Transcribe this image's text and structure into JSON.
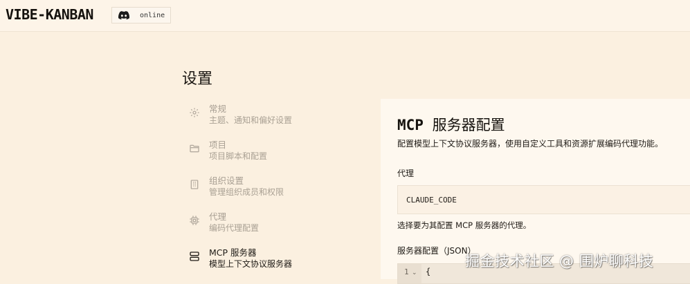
{
  "app": {
    "logo": "VIBE-KANBAN",
    "discord_status": "online",
    "discord_icon": "discord-icon"
  },
  "settings": {
    "title": "设置"
  },
  "sidebar": {
    "items": [
      {
        "label": "常规",
        "desc": "主题、通知和偏好设置",
        "icon": "gear-icon"
      },
      {
        "label": "项目",
        "desc": "项目脚本和配置",
        "icon": "folder-icon"
      },
      {
        "label": "组织设置",
        "desc": "管理组织成员和权限",
        "icon": "building-icon"
      },
      {
        "label": "代理",
        "desc": "编码代理配置",
        "icon": "cpu-icon"
      },
      {
        "label": "MCP 服务器",
        "desc": "模型上下文协议服务器",
        "icon": "server-icon",
        "active": true
      }
    ]
  },
  "mcp": {
    "title_prefix": "MCP",
    "title_suffix": "服务器配置",
    "description": "配置模型上下文协议服务器，使用自定义工具和资源扩展编码代理功能。",
    "agent_label": "代理",
    "agent_value": "CLAUDE_CODE",
    "agent_hint": "选择要为其配置 MCP 服务器的代理。",
    "json_label": "服务器配置（JSON）",
    "editor": {
      "line_number": "1",
      "fold": "⌄",
      "code": "{"
    }
  },
  "watermark": "掘金技术社区 @ 围炉聊科技"
}
